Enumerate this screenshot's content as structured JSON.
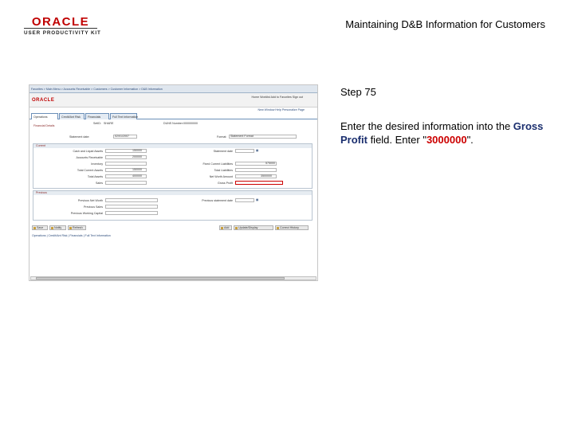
{
  "logo": {
    "brand": "ORACLE",
    "subtitle": "USER PRODUCTIVITY KIT"
  },
  "doc_title": "Maintaining D&B Information for Customers",
  "step": {
    "label": "Step 75"
  },
  "instruction": {
    "prefix": "Enter the desired information into the ",
    "field": "Gross Profit",
    "middle": " field. Enter \"",
    "value": "3000000",
    "suffix": "\"."
  },
  "screenshot": {
    "brand": "ORACLE",
    "menu_links": "Home  Worklist  Add to Favorites  Sign out",
    "header_links": "New Window  Help  Personalize Page",
    "breadcrumb": "Favorites  >  Main Menu  >  Accounts Receivable  >  Customers  >  Customer Information  >  D&B Information",
    "tabs": [
      "Operations",
      "Credit/Ant Risk",
      "Financials",
      "Full Text Information"
    ],
    "setid_label": "SetID:",
    "setid_value": "SHARE",
    "duns_label": "DUNS Number:",
    "duns_value": "000000000",
    "page_title": "Financial Details",
    "stmt_date_label": "Statement date:",
    "stmt_date_value": "02/01/2007",
    "format_label": "Format:",
    "format_value": "Statement Format",
    "current_section": "Current",
    "previous_section": "Previous",
    "left_labels": [
      "Cash and Liquid Assets",
      "Accounts Receivable",
      "Inventory",
      "Total Current Assets",
      "Total Assets",
      "Sales"
    ],
    "left_values": [
      "150000",
      "200000",
      "",
      "150000",
      "400000",
      ""
    ],
    "right_labels": [
      "Statement date",
      "Fixed Current Liabilities",
      "Total Liabilities",
      "Net Worth Amount",
      "Gross Profit"
    ],
    "right_values": [
      "",
      "575000",
      "",
      "3500000",
      ""
    ],
    "prev_left_labels": [
      "Previous Net Worth",
      "Previous Sales",
      "Previous Working Capital"
    ],
    "prev_right_labels": [
      "Previous statement date"
    ],
    "buttons": [
      "Save",
      "Notify",
      "Refresh",
      "Add",
      "Update/Display",
      "Correct History"
    ],
    "footer_links": "Operations | Credit/Ant Risk | Financials | Full Text Information"
  }
}
